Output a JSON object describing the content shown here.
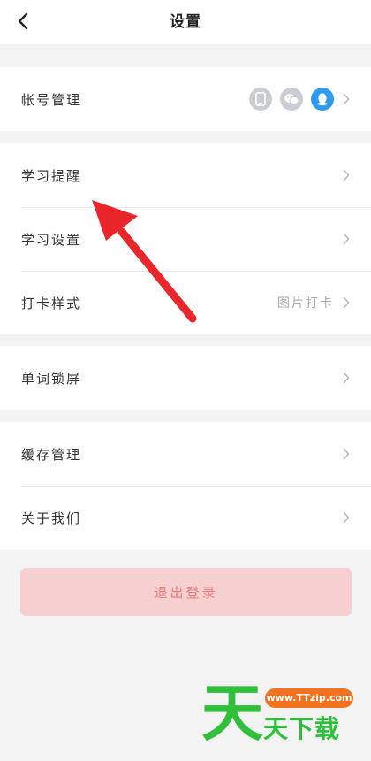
{
  "header": {
    "title": "设置",
    "back_icon": "chevron-left-icon"
  },
  "groups": [
    {
      "items": [
        {
          "label": "帐号管理",
          "bound_accounts": [
            "phone-icon",
            "wechat-icon",
            "qq-icon"
          ]
        }
      ]
    },
    {
      "items": [
        {
          "label": "学习提醒"
        },
        {
          "label": "学习设置"
        },
        {
          "label": "打卡样式",
          "value": "图片打卡"
        }
      ]
    },
    {
      "items": [
        {
          "label": "单词锁屏"
        }
      ]
    },
    {
      "items": [
        {
          "label": "缓存管理"
        },
        {
          "label": "关于我们"
        }
      ]
    }
  ],
  "logout_label": "退出登录",
  "colors": {
    "accent_qq": "#2e9bf2",
    "logout_bg": "#f6d0d0",
    "logout_text": "#e97b7b",
    "annotation_arrow": "#e8262b"
  },
  "watermark": {
    "big_char": "天",
    "url": "www.TTzip.com",
    "text": "天下载"
  }
}
